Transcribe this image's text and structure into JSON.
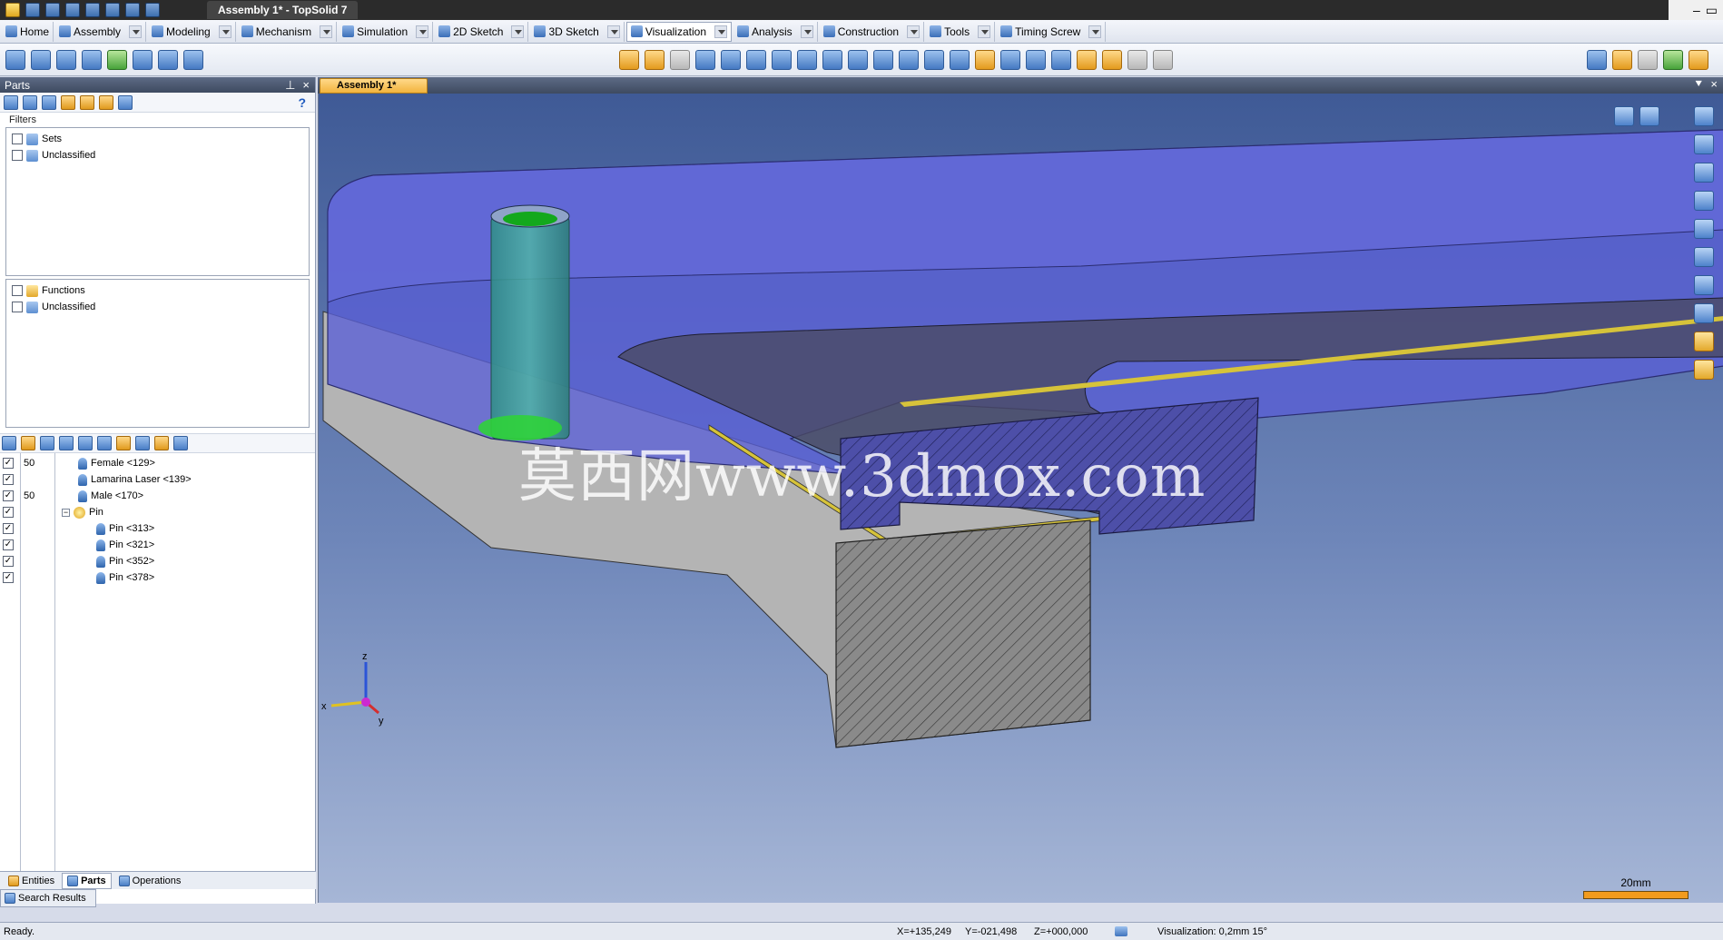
{
  "window": {
    "title": "Assembly 1* - TopSolid 7"
  },
  "ribbon": {
    "tabs": [
      {
        "label": "Home"
      },
      {
        "label": "Assembly"
      },
      {
        "label": "Modeling"
      },
      {
        "label": "Mechanism"
      },
      {
        "label": "Simulation"
      },
      {
        "label": "2D Sketch"
      },
      {
        "label": "3D Sketch"
      },
      {
        "label": "Visualization"
      },
      {
        "label": "Analysis"
      },
      {
        "label": "Construction"
      },
      {
        "label": "Tools"
      },
      {
        "label": "Timing Screw"
      }
    ],
    "active_tab": "Visualization"
  },
  "parts_panel": {
    "title": "Parts",
    "filters_label": "Filters",
    "help": "?",
    "filter_groups": [
      {
        "items": [
          {
            "label": "Sets"
          },
          {
            "label": "Unclassified"
          }
        ]
      },
      {
        "items": [
          {
            "label": "Functions"
          },
          {
            "label": "Unclassified"
          }
        ]
      }
    ],
    "tree": [
      {
        "count": "50",
        "label": "Female <129>",
        "checked": "✓"
      },
      {
        "count": "",
        "label": "Lamarina Laser <139>",
        "checked": "✓"
      },
      {
        "count": "50",
        "label": "Male <170>",
        "checked": "✓"
      },
      {
        "count": "",
        "label": "Pin",
        "checked": "✓",
        "expander": "−"
      },
      {
        "count": "",
        "label": "Pin <313>",
        "checked": "✓"
      },
      {
        "count": "",
        "label": "Pin <321>",
        "checked": "✓"
      },
      {
        "count": "",
        "label": "Pin <352>",
        "checked": "✓"
      },
      {
        "count": "",
        "label": "Pin <378>",
        "checked": "✓"
      }
    ],
    "bottom_tabs": [
      {
        "label": "Entities"
      },
      {
        "label": "Parts"
      },
      {
        "label": "Operations"
      }
    ],
    "search_results": "Search Results"
  },
  "document": {
    "tab_label": "Assembly 1*",
    "watermark": "莫西网www.3dmox.com",
    "triad": {
      "x": "x",
      "y": "y",
      "z": "z"
    },
    "scale_label": "20mm"
  },
  "status": {
    "ready": "Ready.",
    "x": "X=+135,249",
    "y": "Y=-021,498",
    "z": "Z=+000,000",
    "visualization": "Visualization: 0,2mm 15°"
  },
  "colors": {
    "accent_orange": "#f2b33d",
    "viewport_top": "#3f5a96",
    "part_blue": "#5a5fd6",
    "part_gray": "#b9b9b9",
    "pin_green": "#1fbf2a"
  },
  "icons": {
    "qa": [
      "app-icon",
      "save-icon",
      "save-all-icon",
      "print-icon",
      "undo-icon",
      "redo-icon",
      "pen-icon",
      "refresh-icon"
    ],
    "close": "×",
    "pin": "⊥",
    "minimize": "–"
  }
}
